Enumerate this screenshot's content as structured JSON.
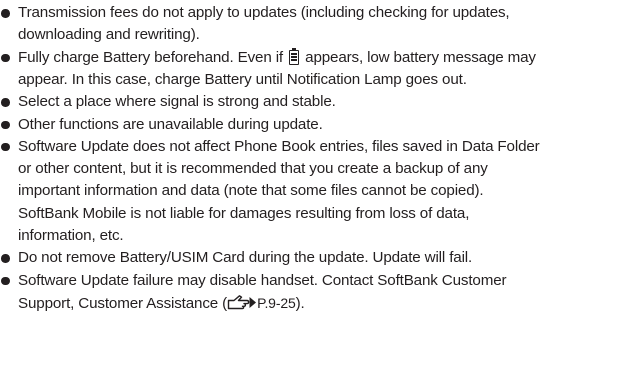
{
  "bullets": [
    {
      "lines": [
        "Transmission fees do not apply to updates (including checking for updates,",
        "downloading and rewriting)."
      ]
    },
    {
      "line1_before_icon": "Fully charge Battery beforehand. Even if ",
      "icon": "battery-icon",
      "line1_after_icon": " appears, low battery message may",
      "line2": "appear. In this case, charge Battery until Notification Lamp goes out."
    },
    {
      "lines": [
        "Select a place where signal is strong and stable."
      ]
    },
    {
      "lines": [
        "Other functions are unavailable during update."
      ]
    },
    {
      "lines": [
        "Software Update does not affect Phone Book entries, files saved in Data Folder",
        "or other content, but it is recommended that you create a backup of any",
        "important information and data (note that some files cannot be copied).",
        "SoftBank Mobile is not liable for damages resulting from loss of data,",
        "information, etc."
      ]
    },
    {
      "lines": [
        "Do not remove Battery/USIM Card during the update. Update will fail."
      ]
    },
    {
      "line1": "Software Update failure may disable handset. Contact SoftBank Customer",
      "line2_before_icon": "Support, Customer Assistance (",
      "icon": "page-reference-icon",
      "page_ref": "P.9-25",
      "line2_after_ref": ")."
    }
  ]
}
